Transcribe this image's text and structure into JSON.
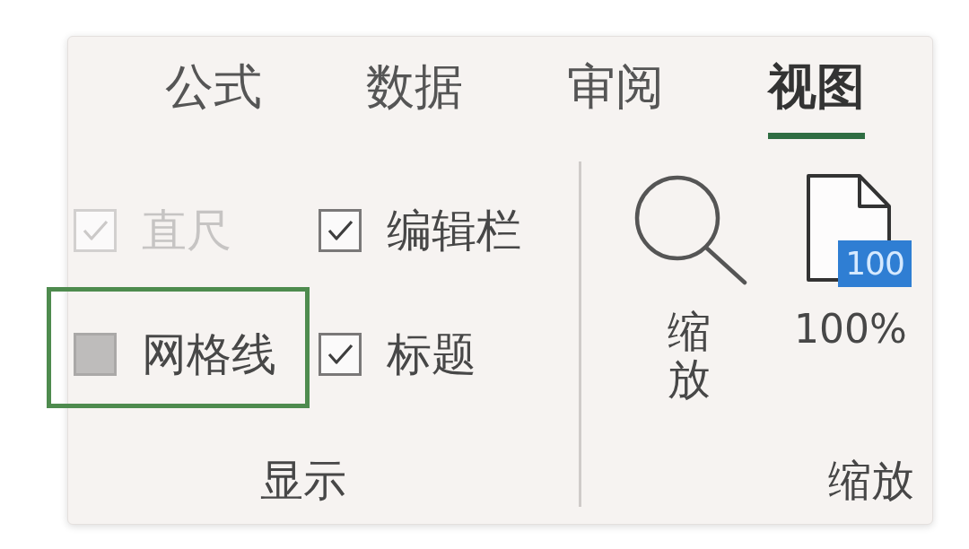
{
  "tabs": [
    {
      "label": "公式",
      "selected": false
    },
    {
      "label": "数据",
      "selected": false
    },
    {
      "label": "审阅",
      "selected": false
    },
    {
      "label": "视图",
      "selected": true
    }
  ],
  "display_group": {
    "label": "显示",
    "options": [
      {
        "label": "直尺",
        "checked": true,
        "disabled": true,
        "pressed": false,
        "highlighted": false
      },
      {
        "label": "编辑栏",
        "checked": true,
        "disabled": false,
        "pressed": false,
        "highlighted": false
      },
      {
        "label": "网格线",
        "checked": false,
        "disabled": false,
        "pressed": true,
        "highlighted": true
      },
      {
        "label": "标题",
        "checked": true,
        "disabled": false,
        "pressed": false,
        "highlighted": false
      }
    ]
  },
  "zoom_group": {
    "label": "缩放",
    "buttons": [
      {
        "kind": "zoom",
        "label": "缩放"
      },
      {
        "kind": "page_100",
        "label": "100%",
        "badge": "100"
      }
    ]
  }
}
